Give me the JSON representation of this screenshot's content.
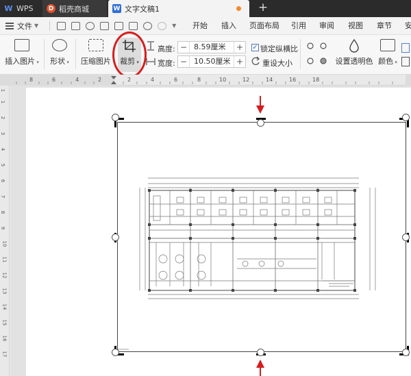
{
  "tabs": {
    "wps": "WPS",
    "store": "稻壳商城",
    "document": "文字文稿1",
    "add": "+"
  },
  "menubar": {
    "file": "文件",
    "items": [
      "开始",
      "插入",
      "页面布局",
      "引用",
      "审阅",
      "视图",
      "章节",
      "安"
    ]
  },
  "ribbon": {
    "insert_picture": "插入图片",
    "shape": "形状",
    "compress_picture": "压缩图片",
    "crop": "裁剪",
    "height_label": "高度:",
    "height_value": "8.59厘米",
    "width_label": "宽度:",
    "width_value": "10.50厘米",
    "lock_ratio": "锁定纵横比",
    "reset_size": "重设大小",
    "set_transparent": "设置透明色",
    "color": "颜色"
  },
  "ruler": {
    "h_labels": [
      "8",
      "6",
      "4",
      "2",
      "2",
      "4",
      "6",
      "8",
      "10",
      "12",
      "14",
      "16",
      "18"
    ],
    "v_labels": [
      "1",
      "1",
      "2",
      "3",
      "4",
      "5",
      "6",
      "7",
      "8",
      "9",
      "10",
      "11",
      "12",
      "13",
      "14",
      "15",
      "16",
      "17"
    ]
  },
  "colors": {
    "annotation_red": "#d61d1d",
    "title_bar": "#2b2b2b",
    "wps_blue": "#2f6fd6"
  }
}
